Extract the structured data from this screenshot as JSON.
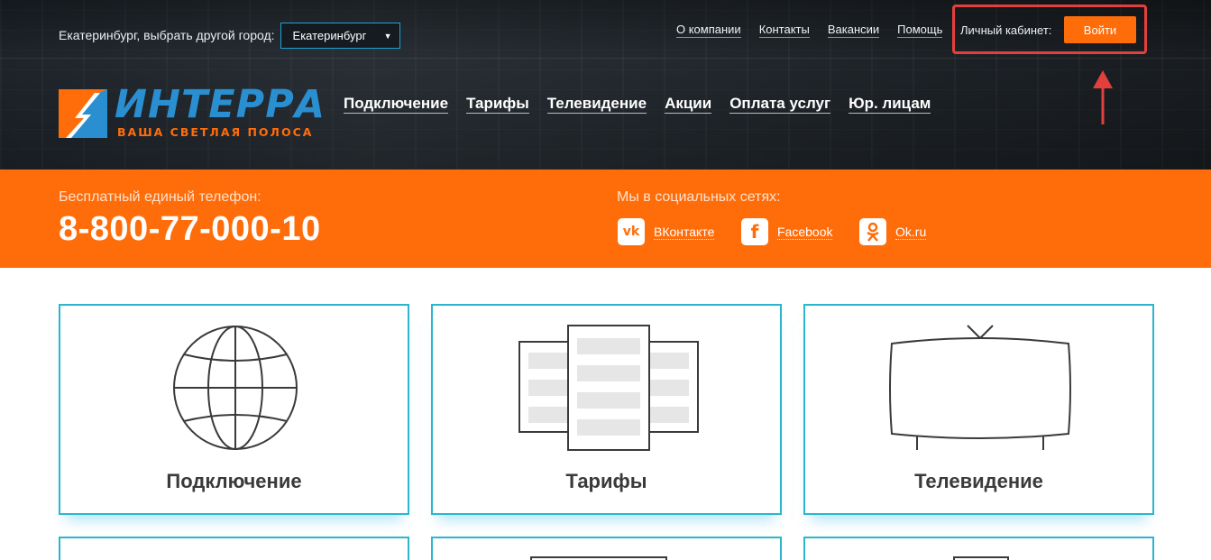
{
  "header": {
    "city_label": "Екатеринбург, выбрать другой город:",
    "city_selected": "Екатеринбург",
    "top_links": [
      "О компании",
      "Контакты",
      "Вакансии",
      "Помощь"
    ],
    "cabinet_label": "Личный кабинет:",
    "login_button": "Войти",
    "logo_name": "ИНТЕРРА",
    "logo_slogan": "ВАША СВЕТЛАЯ ПОЛОСА",
    "main_nav": [
      "Подключение",
      "Тарифы",
      "Телевидение",
      "Акции",
      "Оплата услуг",
      "Юр. лицам"
    ]
  },
  "contact_band": {
    "phone_label": "Бесплатный единый телефон:",
    "phone": "8-800-77-000-10",
    "social_label": "Мы в социальных сетях:",
    "social": [
      {
        "icon": "vk-icon",
        "label": "ВКонтакте"
      },
      {
        "icon": "facebook-icon",
        "label": "Facebook"
      },
      {
        "icon": "odnoklassniki-icon",
        "label": "Ok.ru"
      }
    ]
  },
  "cards": [
    {
      "icon": "globe-icon",
      "label": "Подключение"
    },
    {
      "icon": "tariff-cards-icon",
      "label": "Тарифы"
    },
    {
      "icon": "tv-icon",
      "label": "Телевидение"
    }
  ],
  "colors": {
    "accent_orange": "#ff6d0b",
    "card_border": "#2bb6cf",
    "highlight_red": "#e2403d",
    "logo_blue": "#2a8fd1"
  }
}
